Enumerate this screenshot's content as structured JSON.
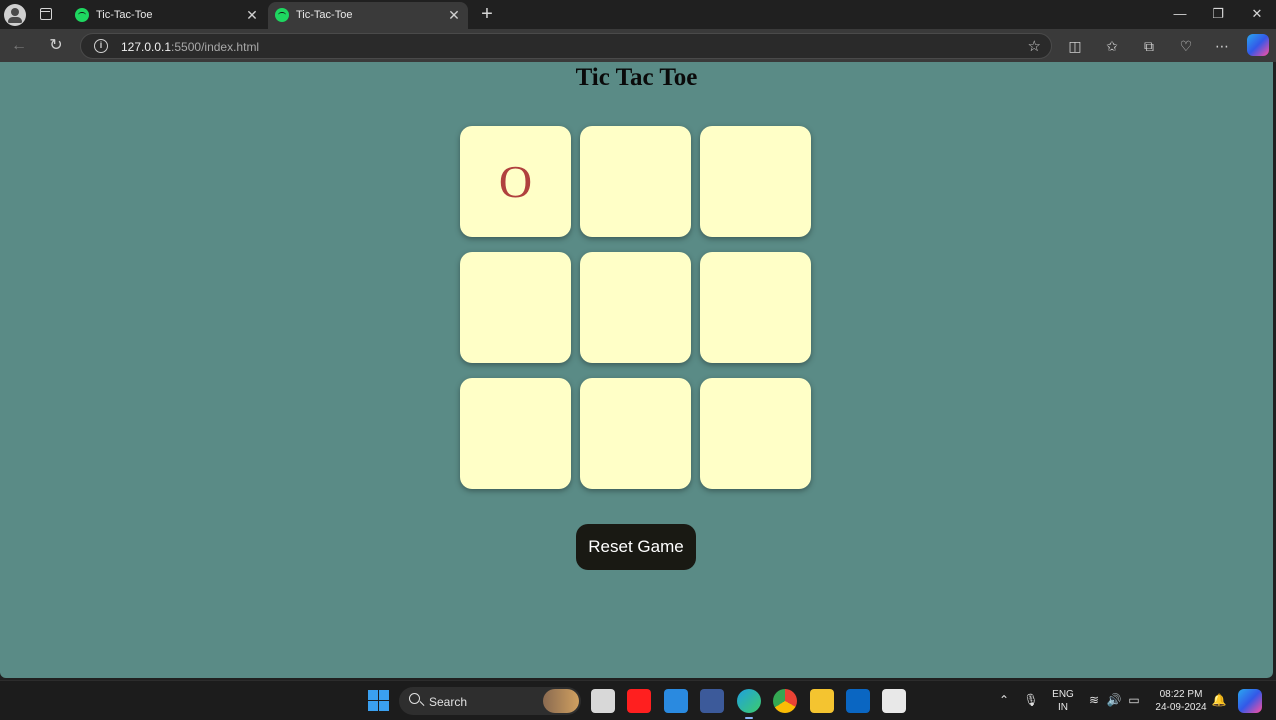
{
  "browser": {
    "tabs": [
      {
        "title": "Tic-Tac-Toe",
        "active": false
      },
      {
        "title": "Tic-Tac-Toe",
        "active": true
      }
    ],
    "url_host": "127.0.0.1",
    "url_path": ":5500/index.html"
  },
  "page": {
    "title": "Tic Tac Toe",
    "board": [
      "O",
      "",
      "",
      "",
      "",
      "",
      "",
      "",
      ""
    ],
    "reset_label": "Reset Game",
    "background_color": "#5a8b86",
    "cell_color": "#ffffc7",
    "mark_color": "#b0413e"
  },
  "taskbar": {
    "search_label": "Search",
    "lang_line1": "ENG",
    "lang_line2": "IN",
    "time": "08:22 PM",
    "date": "24-09-2024"
  }
}
